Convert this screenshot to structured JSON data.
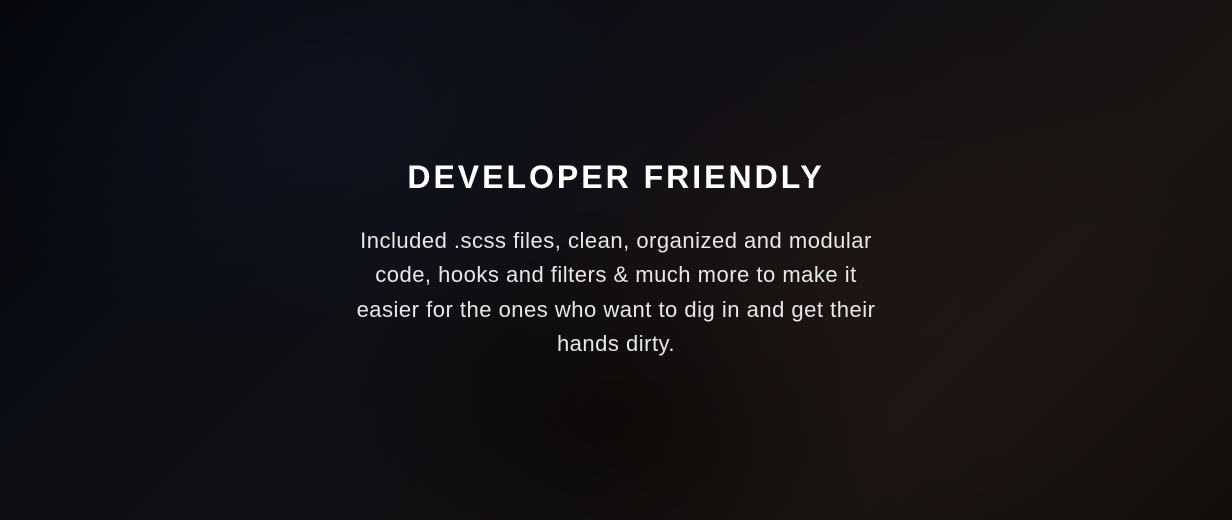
{
  "hero": {
    "heading": "DEVELOPER FRIENDLY",
    "description": "Included .scss files, clean, organized and modular code, hooks and filters & much more to make it easier for the ones who want to dig in and get their hands dirty."
  }
}
